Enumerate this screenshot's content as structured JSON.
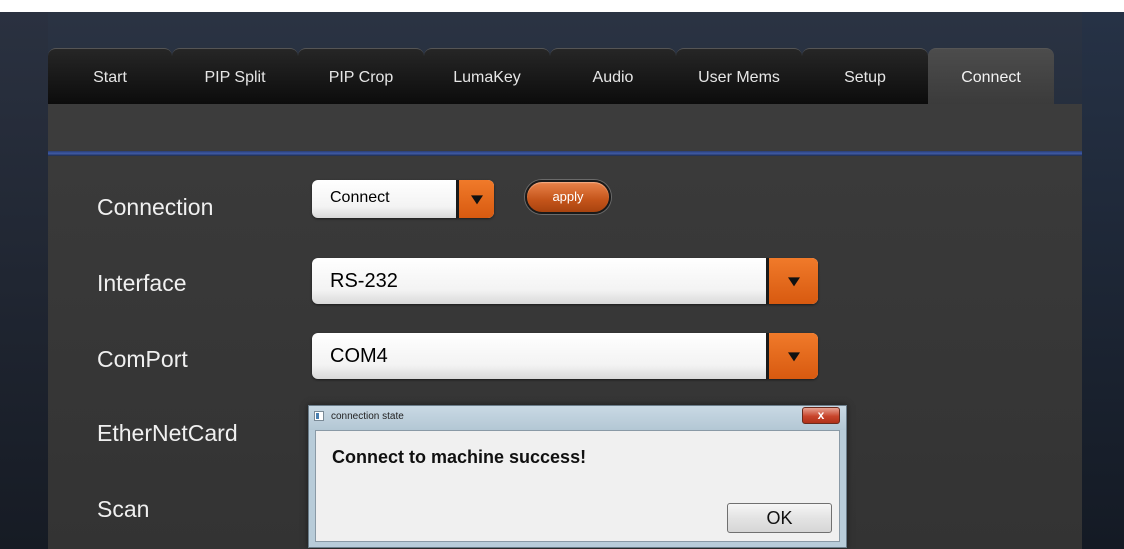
{
  "tabs": [
    {
      "label": "Start",
      "active": false
    },
    {
      "label": "PIP Split",
      "active": false
    },
    {
      "label": "PIP Crop",
      "active": false
    },
    {
      "label": "LumaKey",
      "active": false
    },
    {
      "label": "Audio",
      "active": false
    },
    {
      "label": "User Mems",
      "active": false
    },
    {
      "label": "Setup",
      "active": false
    },
    {
      "label": "Connect",
      "active": true
    }
  ],
  "form": {
    "connection_label": "Connection",
    "connection_value": "Connect",
    "apply_label": "apply",
    "interface_label": "Interface",
    "interface_value": "RS-232",
    "comport_label": "ComPort",
    "comport_value": "COM4",
    "ethernet_label": "EtherNetCard",
    "scan_label": "Scan"
  },
  "dialog": {
    "title": "connection state",
    "close_label": "x",
    "message": "Connect to machine success!",
    "ok_label": "OK"
  },
  "colors": {
    "accent_orange": "#e0651a",
    "panel": "#3a3a3a",
    "tab_active": "#424242",
    "divider_blue": "#3e5aa6"
  },
  "icons": {
    "dropdown": "chevron-down-icon",
    "close": "close-icon",
    "window": "window-icon"
  }
}
